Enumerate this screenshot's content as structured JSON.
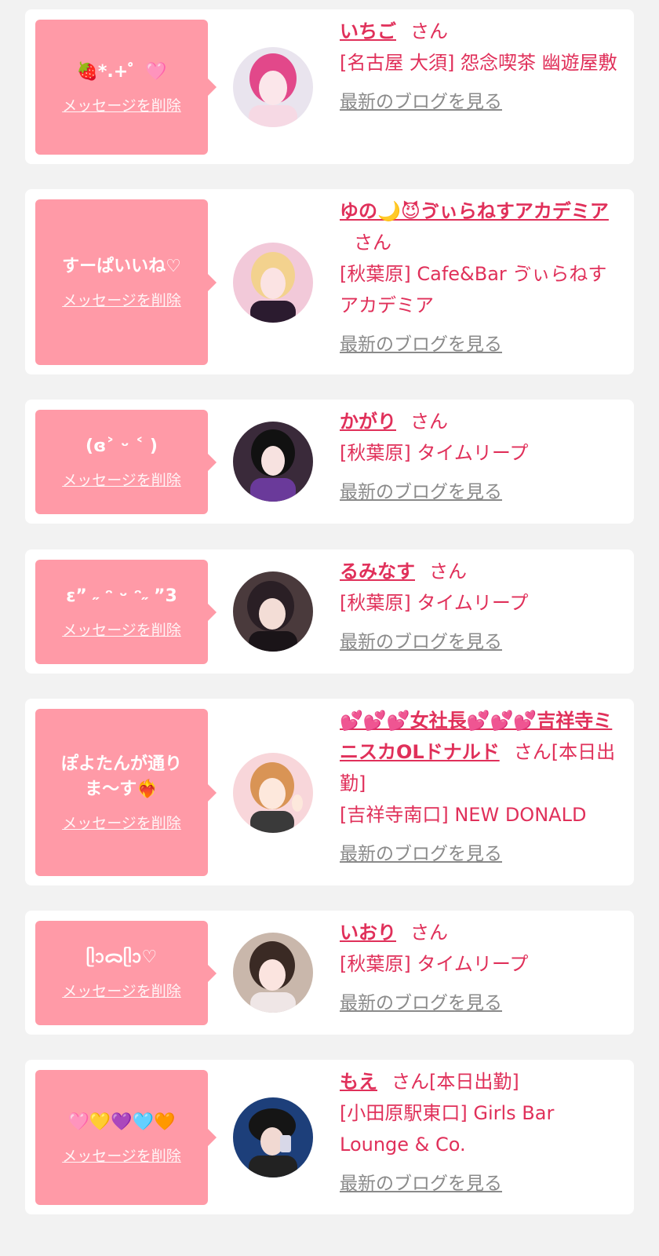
{
  "delete_label": "メッセージを削除",
  "san_label": "さん",
  "blog_label": "最新のブログを見る",
  "colors": {
    "accent": "#e0305a",
    "bubble": "#ff9aa7",
    "link_gray": "#8a8a8a",
    "background": "#f2f2f2"
  },
  "items": [
    {
      "message": "🍓*.+゜🩷",
      "name": "いちご",
      "suffix": "",
      "shop": "[名古屋 大須] 怨念喫茶 幽遊屋敷"
    },
    {
      "message": "すーぱいいね♡",
      "name": "ゆの🌙😈ゔぃらねすアカデミア",
      "suffix": "",
      "shop": "[秋葉原] Cafe&Bar ゔぃらねすアカデミア"
    },
    {
      "message": "(ɞ˃ ᵕ ˂ )",
      "name": "かがり",
      "suffix": "",
      "shop": "[秋葉原] タイムリープ"
    },
    {
      "message": "ε” ˶ ᵔ ᵕ ᵔ˶ ”3",
      "name": "るみなす",
      "suffix": "",
      "shop": "[秋葉原] タイムリープ"
    },
    {
      "message": "ぽよたんが通りま〜す❤️‍🔥",
      "name": "💕💕💕女社長💕💕💕吉祥寺ミニスカOLドナルド",
      "suffix": "[本日出勤]",
      "shop": "[吉祥寺南口] NEW DONALD"
    },
    {
      "message": "ᥫᩣᯅᥫᩣ♡",
      "name": "いおり",
      "suffix": "",
      "shop": "[秋葉原] タイムリープ"
    },
    {
      "message": "🩷💛💜🩵🧡",
      "name": "もえ",
      "suffix": "[本日出勤]",
      "shop": "[小田原駅東口] Girls Bar Lounge & Co."
    }
  ]
}
